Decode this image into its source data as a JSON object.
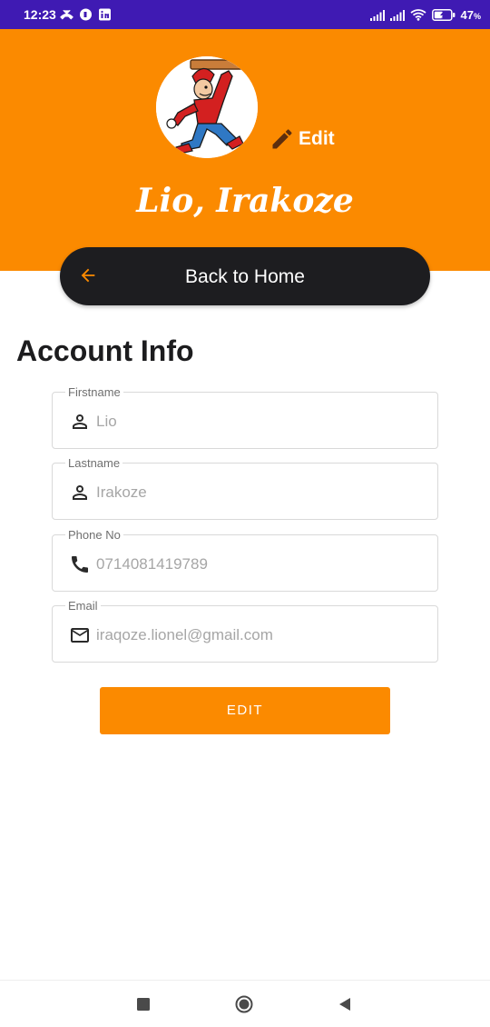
{
  "status_bar": {
    "time": "12:23",
    "battery": "47"
  },
  "header": {
    "edit_photo_label": "Edit",
    "user_name": "Lio, Irakoze",
    "background": "#fb8a00"
  },
  "back_button": {
    "label": "Back to Home"
  },
  "account": {
    "title": "Account Info",
    "fields": [
      {
        "label": "Firstname",
        "value": "Lio",
        "icon": "person-icon"
      },
      {
        "label": "Lastname",
        "value": "Irakoze",
        "icon": "person-icon"
      },
      {
        "label": "Phone No",
        "value": "0714081419789",
        "icon": "phone-icon"
      },
      {
        "label": "Email",
        "value": "iraqoze.lionel@gmail.com",
        "icon": "mail-icon"
      }
    ],
    "edit_button_label": "EDIT"
  },
  "colors": {
    "accent": "#fb8a00",
    "status_bar": "#3f1ab3",
    "dark_button": "#1d1d20"
  }
}
